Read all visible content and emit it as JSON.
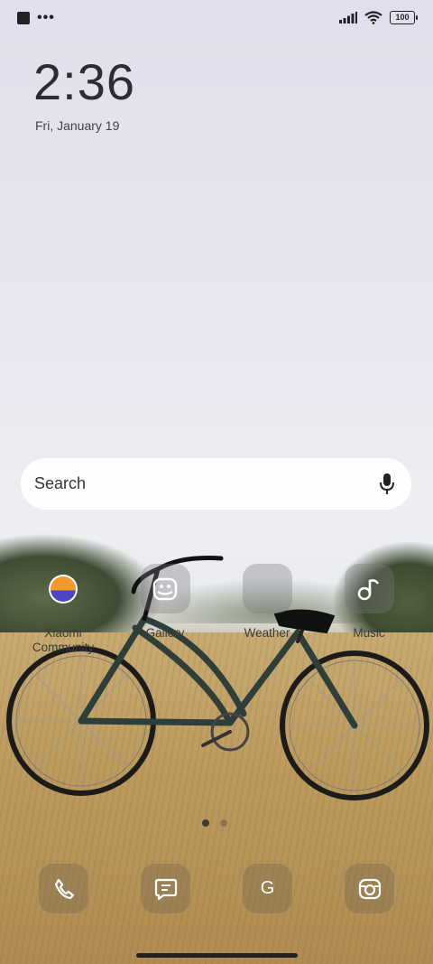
{
  "status_bar": {
    "battery": "100",
    "icons": [
      "notification-square-icon",
      "more-dots-icon",
      "signal-icon",
      "wifi-icon",
      "battery-icon"
    ]
  },
  "lockscreen": {
    "time": "2:36",
    "date": "Fri, January 19"
  },
  "search": {
    "label": "Search",
    "icon": "mic-icon"
  },
  "apps": [
    {
      "label": "Xiaomi Community",
      "icon": "xiaomi-community-icon"
    },
    {
      "label": "Gallery",
      "icon": "gallery-icon"
    },
    {
      "label": "Weather",
      "icon": "weather-icon"
    },
    {
      "label": "Music",
      "icon": "music-icon"
    }
  ],
  "pages": {
    "count": 2,
    "active": 1
  },
  "dock": [
    {
      "icon": "phone-icon"
    },
    {
      "icon": "messages-icon"
    },
    {
      "icon": "google-icon",
      "glyph": "G"
    },
    {
      "icon": "camera-icon"
    }
  ],
  "colors": {
    "text": "#2c2c33",
    "tile": "#78787d"
  }
}
